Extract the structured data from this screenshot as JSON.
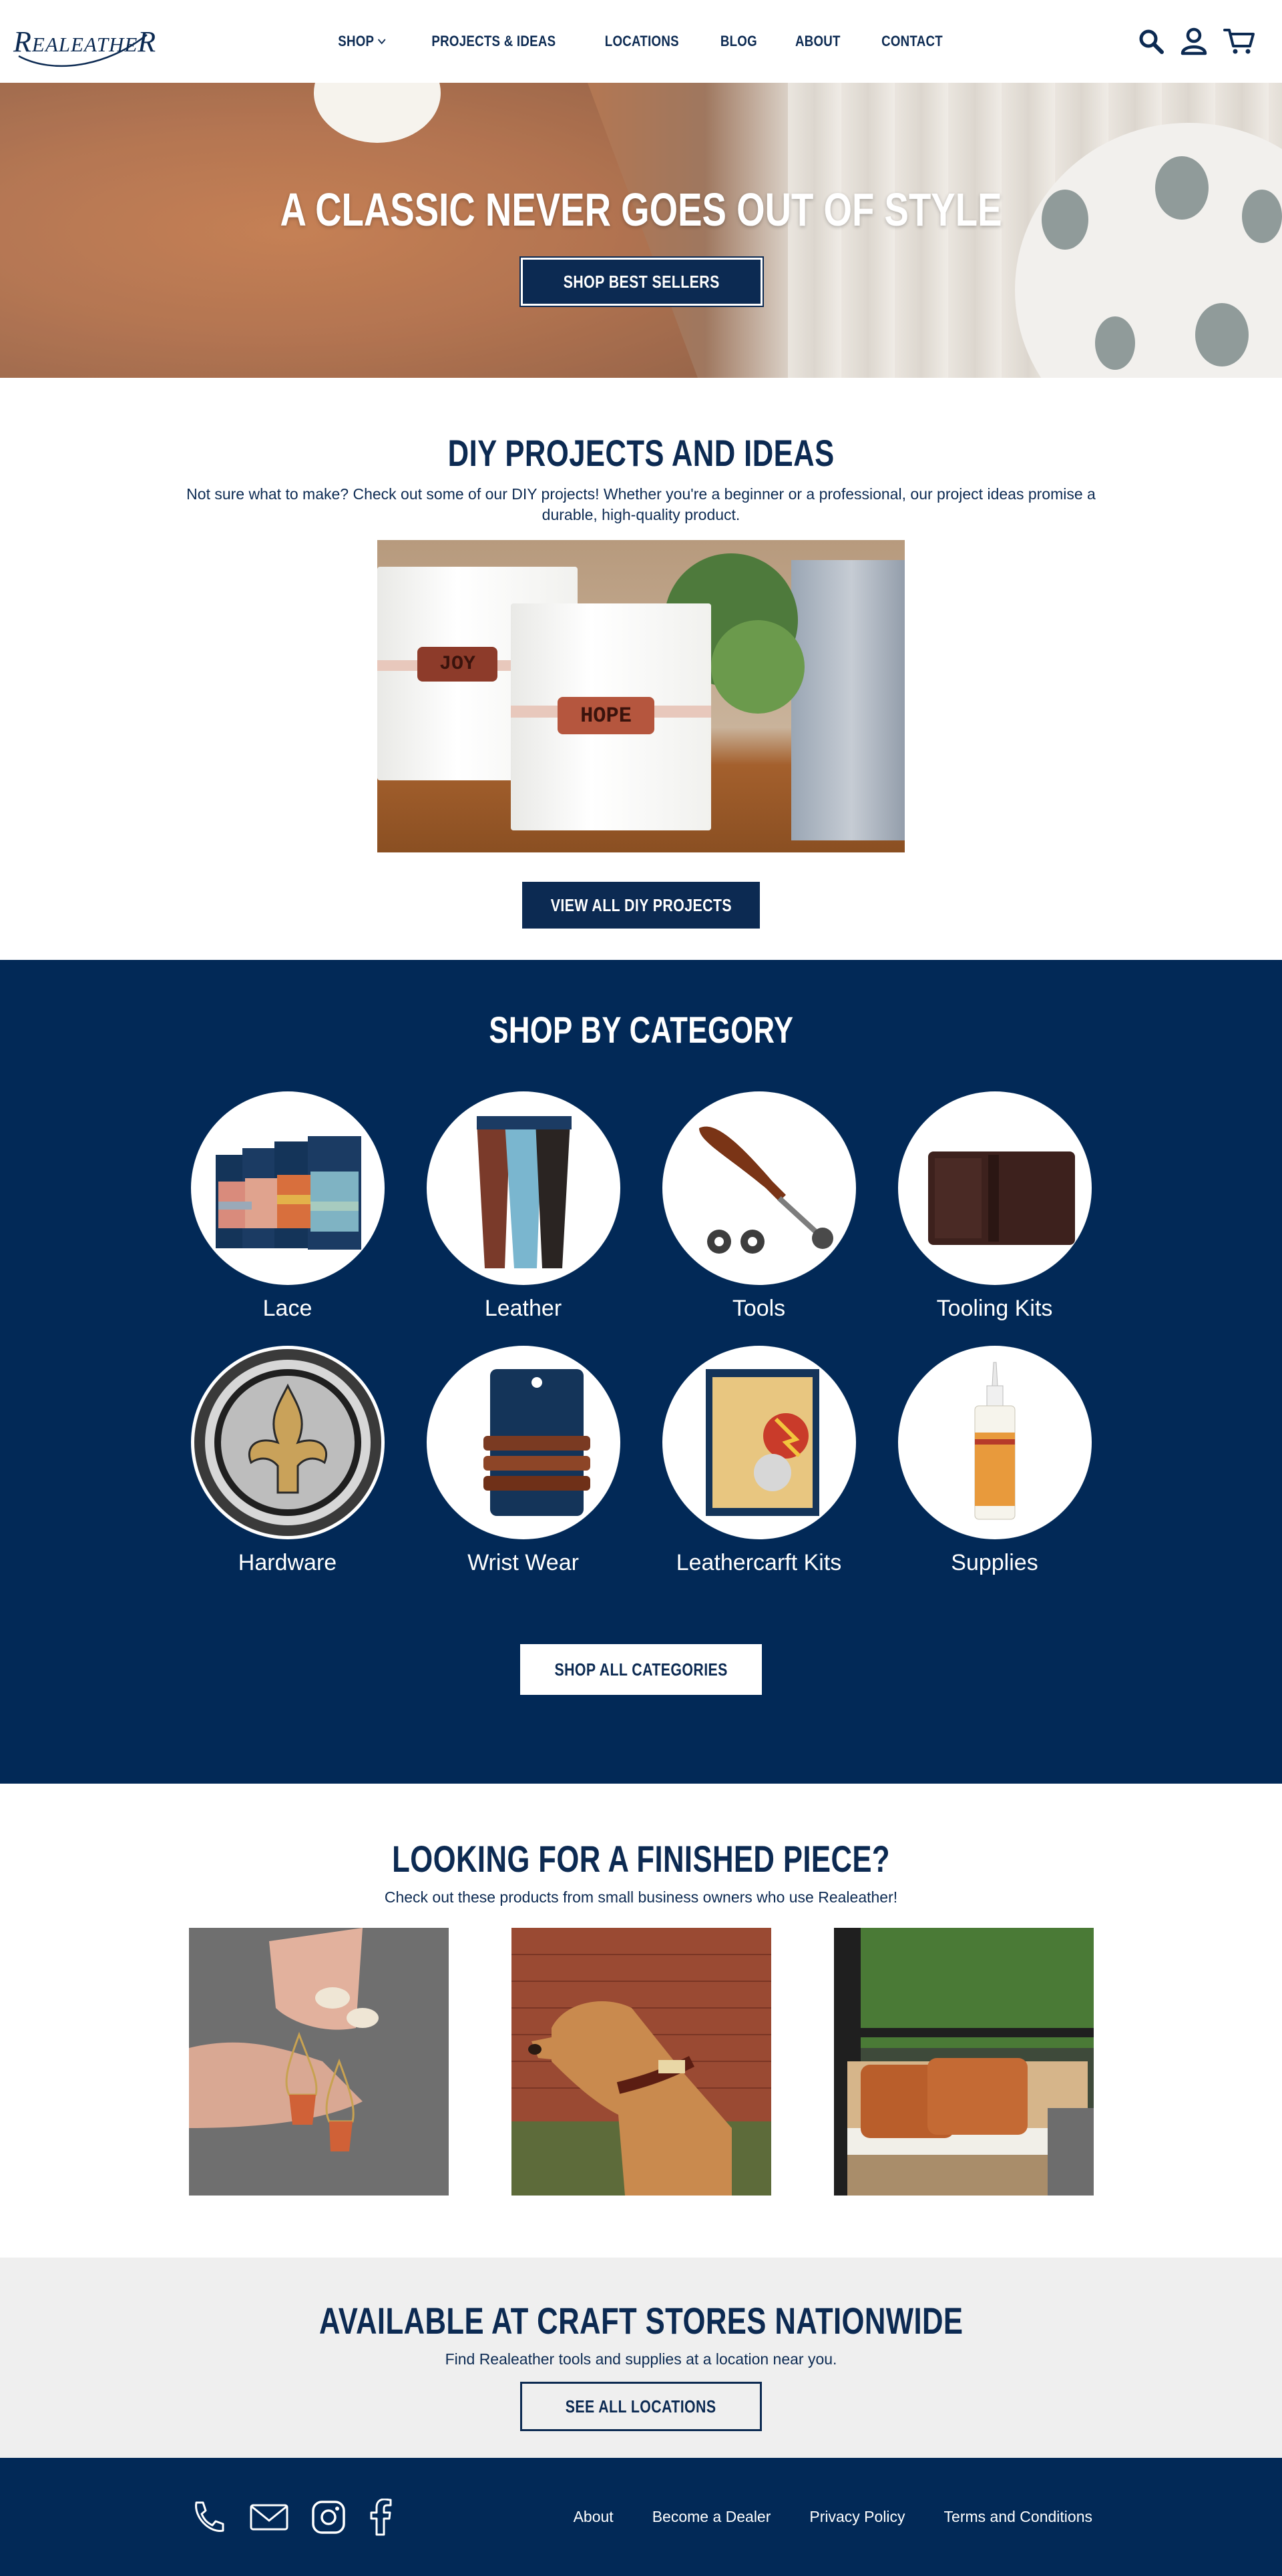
{
  "header": {
    "logo": "RealeatheR",
    "nav": [
      {
        "label": "SHOP"
      },
      {
        "label": "PROJECTS & IDEAS"
      },
      {
        "label": "LOCATIONS"
      },
      {
        "label": "BLOG"
      },
      {
        "label": "ABOUT"
      },
      {
        "label": "CONTACT"
      }
    ],
    "icons": [
      "search-icon",
      "account-icon",
      "cart-icon"
    ]
  },
  "hero": {
    "title": "A CLASSIC NEVER GOES OUT OF STYLE",
    "button": "SHOP BEST SELLERS"
  },
  "diy": {
    "title": "DIY PROJECTS AND IDEAS",
    "description": "Not sure what to make? Check out some of our DIY projects! Whether you're a beginner or a professional, our project ideas promise a durable, high-quality product.",
    "tag_joy": "JOY",
    "tag_hope": "HOPE",
    "button": "VIEW ALL DIY PROJECTS"
  },
  "category": {
    "title": "SHOP BY CATEGORY",
    "items": [
      {
        "label": "Lace"
      },
      {
        "label": "Leather"
      },
      {
        "label": "Tools"
      },
      {
        "label": "Tooling Kits"
      },
      {
        "label": "Hardware"
      },
      {
        "label": "Wrist Wear"
      },
      {
        "label": "Leathercarft Kits"
      },
      {
        "label": "Supplies"
      }
    ],
    "button": "SHOP ALL CATEGORIES"
  },
  "finished": {
    "title": "LOOKING FOR A FINISHED PIECE?",
    "description": "Check out these products from small business owners who use Realeather!"
  },
  "locations": {
    "title": "AVAILABLE AT CRAFT STORES NATIONWIDE",
    "description": "Find Realeather tools and supplies at a location near you.",
    "button": "SEE ALL LOCATIONS"
  },
  "footer": {
    "icons": [
      "phone-icon",
      "mail-icon",
      "instagram-icon",
      "facebook-icon"
    ],
    "links": [
      {
        "label": "About"
      },
      {
        "label": "Become a Dealer"
      },
      {
        "label": "Privacy Policy"
      },
      {
        "label": "Terms and Conditions"
      }
    ]
  },
  "colors": {
    "navy": "#022957",
    "text_navy": "#0c2a52",
    "light_gray": "#efefef",
    "white": "#ffffff"
  }
}
